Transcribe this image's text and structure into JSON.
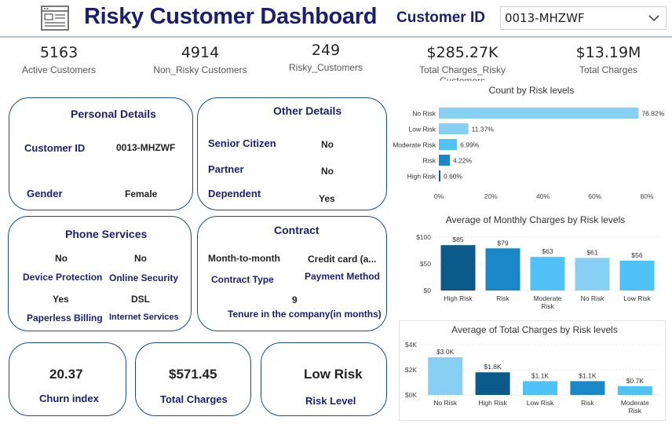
{
  "header": {
    "title": "Risky Customer Dashboard",
    "customer_id_label": "Customer ID",
    "customer_id_value": "0013-MHZWF"
  },
  "kpis": [
    {
      "value": "5163",
      "label": "Active Customers"
    },
    {
      "value": "4914",
      "label": "Non_Risky Customers"
    },
    {
      "value": "249",
      "label": "Risky_Customers"
    },
    {
      "value": "$285.27K",
      "label": "Total Charges_Risky Customers"
    },
    {
      "value": "$13.19M",
      "label": "Total Charges"
    }
  ],
  "personal": {
    "title": "Personal Details",
    "customer_id_label": "Customer ID",
    "customer_id_value": "0013-MHZWF",
    "gender_label": "Gender",
    "gender_value": "Female"
  },
  "other": {
    "title": "Other Details",
    "senior_label": "Senior Citizen",
    "senior_value": "No",
    "partner_label": "Partner",
    "partner_value": "No",
    "dependent_label": "Dependent",
    "dependent_value": "Yes"
  },
  "phone": {
    "title": "Phone Services",
    "device_protection_value": "No",
    "device_protection_label": "Device Protection",
    "online_security_value": "No",
    "online_security_label": "Online Security",
    "paperless_value": "Yes",
    "paperless_label": "Paperless Billing",
    "internet_value": "DSL",
    "internet_label": "Internet Services"
  },
  "contract": {
    "title": "Contract",
    "contract_type_value": "Month-to-month",
    "contract_type_label": "Contract Type",
    "payment_value": "Credit card (a...",
    "payment_label": "Payment Method",
    "tenure_value": "9",
    "tenure_label": "Tenure in the company(in months)"
  },
  "bottom": {
    "churn_value": "20.37",
    "churn_label": "Churn index",
    "charges_value": "$571.45",
    "charges_label": "Total Charges",
    "risk_value": "Low Risk",
    "risk_label": "Risk Level"
  },
  "colors": {
    "navy": "#1b1f6e",
    "dark_blue": "#0b5a8a",
    "mid_blue": "#1a87c9",
    "light_blue": "#4fc3f7",
    "pale_blue": "#87cff3",
    "border": "#1c4f73"
  },
  "chart_data": [
    {
      "type": "bar",
      "orientation": "horizontal",
      "title": "Count by Risk levels",
      "categories": [
        "No Risk",
        "Low Risk",
        "Moderate Risk",
        "Risk",
        "High Risk"
      ],
      "values": [
        76.82,
        11.37,
        6.99,
        4.22,
        0.6
      ],
      "data_labels": [
        "76.82%",
        "11.37%",
        "6.99%",
        "4.22%",
        "0.60%"
      ],
      "xlim": [
        0,
        80
      ],
      "xticks": [
        "0%",
        "20%",
        "40%",
        "60%",
        "80%"
      ]
    },
    {
      "type": "bar",
      "title": "Average of Monthly Charges by Risk levels",
      "categories": [
        "High Risk",
        "Risk",
        "Moderate Risk",
        "No Risk",
        "Low Risk"
      ],
      "values": [
        85,
        79,
        63,
        61,
        56
      ],
      "data_labels": [
        "$85",
        "$79",
        "$63",
        "$61",
        "$56"
      ],
      "ylim": [
        0,
        100
      ],
      "yticks": [
        "$0",
        "$50",
        "$100"
      ]
    },
    {
      "type": "bar",
      "title": "Average of Total Charges by Risk levels",
      "categories": [
        "No Risk",
        "High Risk",
        "Low Risk",
        "Risk",
        "Moderate Risk"
      ],
      "values": [
        3.0,
        1.8,
        1.1,
        1.1,
        0.7
      ],
      "data_labels": [
        "$3.0K",
        "$1.8K",
        "$1.1K",
        "$1.1K",
        "$0.7K"
      ],
      "ylim": [
        0,
        4
      ],
      "yticks": [
        "$0K",
        "$2K",
        "$4K"
      ]
    }
  ]
}
